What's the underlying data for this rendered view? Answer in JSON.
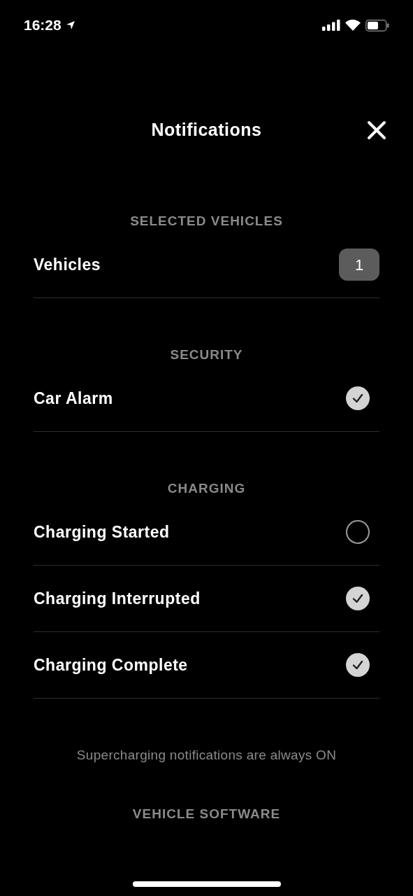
{
  "status_bar": {
    "time": "16:28"
  },
  "title": "Notifications",
  "sections": [
    {
      "header": "SELECTED VEHICLES",
      "rows": [
        {
          "label": "Vehicles",
          "kind": "count",
          "value": "1"
        }
      ]
    },
    {
      "header": "SECURITY",
      "rows": [
        {
          "label": "Car Alarm",
          "kind": "check",
          "checked": true
        }
      ]
    },
    {
      "header": "CHARGING",
      "rows": [
        {
          "label": "Charging Started",
          "kind": "check",
          "checked": false
        },
        {
          "label": "Charging Interrupted",
          "kind": "check",
          "checked": true
        },
        {
          "label": "Charging Complete",
          "kind": "check",
          "checked": true
        }
      ],
      "note": "Supercharging notifications are always ON"
    },
    {
      "header": "VEHICLE SOFTWARE"
    }
  ]
}
